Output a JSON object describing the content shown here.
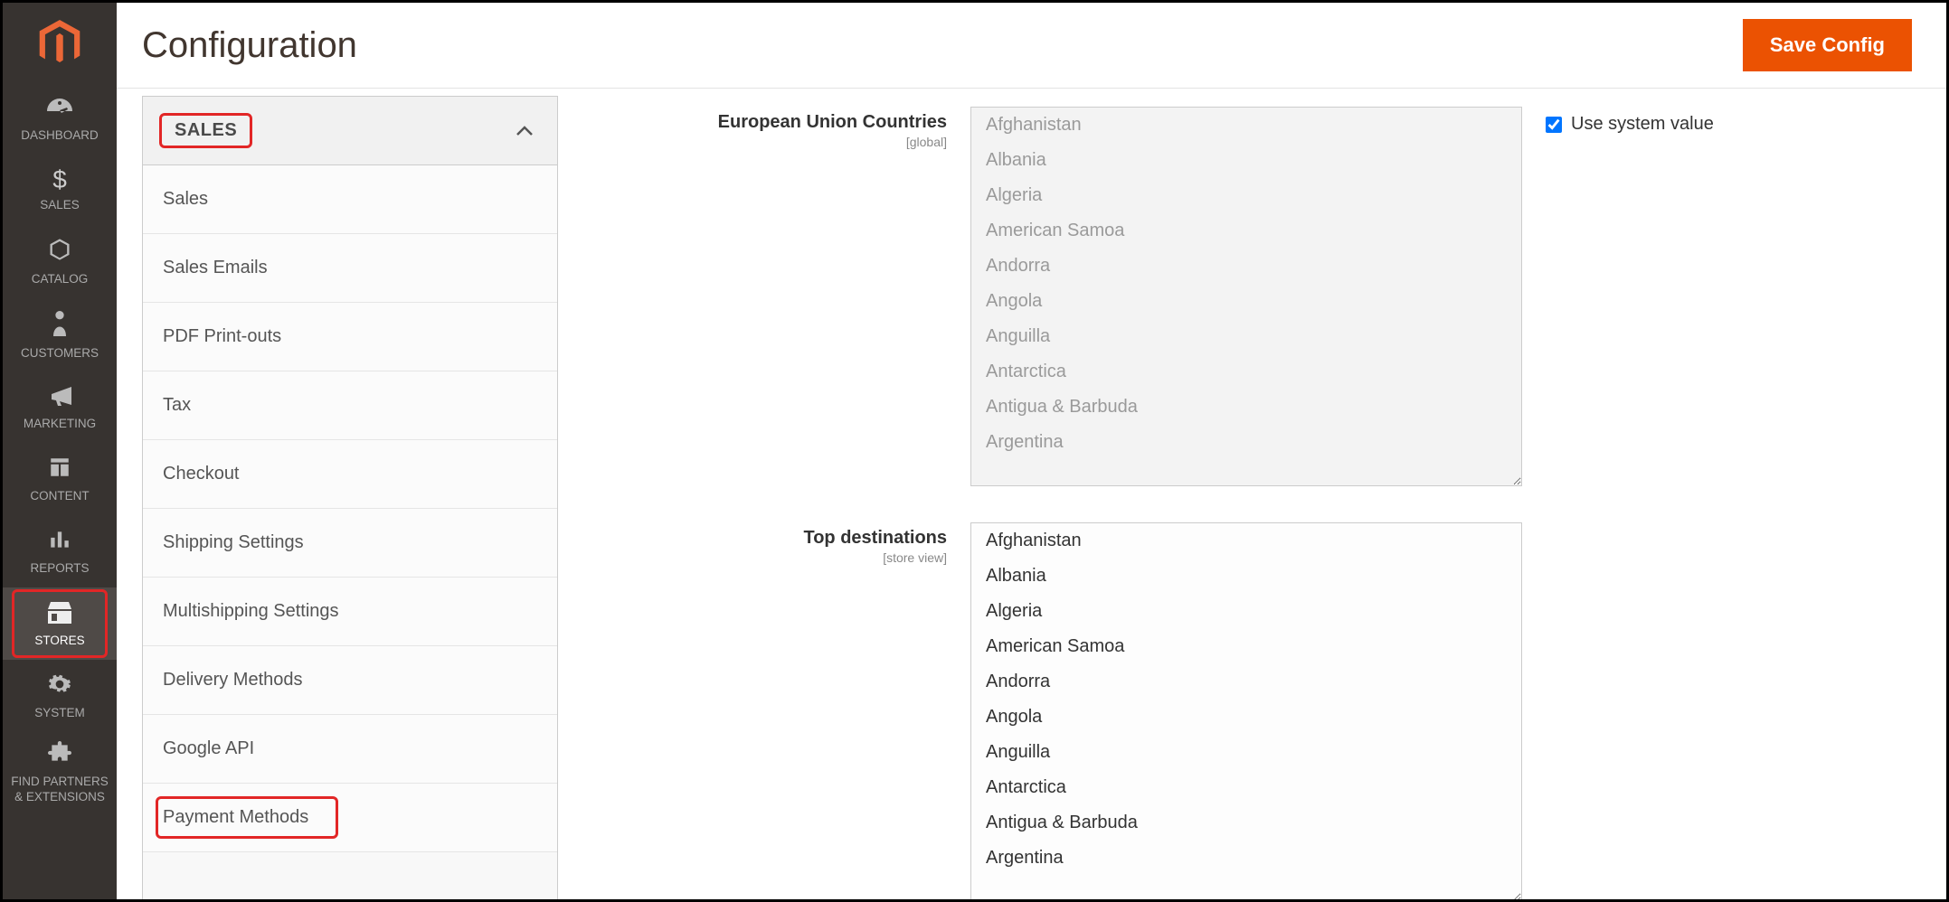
{
  "header": {
    "title": "Configuration",
    "save_label": "Save Config"
  },
  "nav": {
    "items": [
      {
        "id": "dashboard",
        "label": "DASHBOARD"
      },
      {
        "id": "sales",
        "label": "SALES"
      },
      {
        "id": "catalog",
        "label": "CATALOG"
      },
      {
        "id": "customers",
        "label": "CUSTOMERS"
      },
      {
        "id": "marketing",
        "label": "MARKETING"
      },
      {
        "id": "content",
        "label": "CONTENT"
      },
      {
        "id": "reports",
        "label": "REPORTS"
      },
      {
        "id": "stores",
        "label": "STORES"
      },
      {
        "id": "system",
        "label": "SYSTEM"
      },
      {
        "id": "partners",
        "label": "FIND PARTNERS & EXTENSIONS"
      }
    ]
  },
  "config_nav": {
    "section": "SALES",
    "items": [
      "Sales",
      "Sales Emails",
      "PDF Print-outs",
      "Tax",
      "Checkout",
      "Shipping Settings",
      "Multishipping Settings",
      "Delivery Methods",
      "Google API",
      "Payment Methods"
    ]
  },
  "fields": {
    "eu": {
      "label": "European Union Countries",
      "scope": "[global]",
      "use_system_label": "Use system value",
      "use_system_checked": true
    },
    "top": {
      "label": "Top destinations",
      "scope": "[store view]"
    }
  },
  "countries": [
    "Afghanistan",
    "Albania",
    "Algeria",
    "American Samoa",
    "Andorra",
    "Angola",
    "Anguilla",
    "Antarctica",
    "Antigua & Barbuda",
    "Argentina"
  ]
}
